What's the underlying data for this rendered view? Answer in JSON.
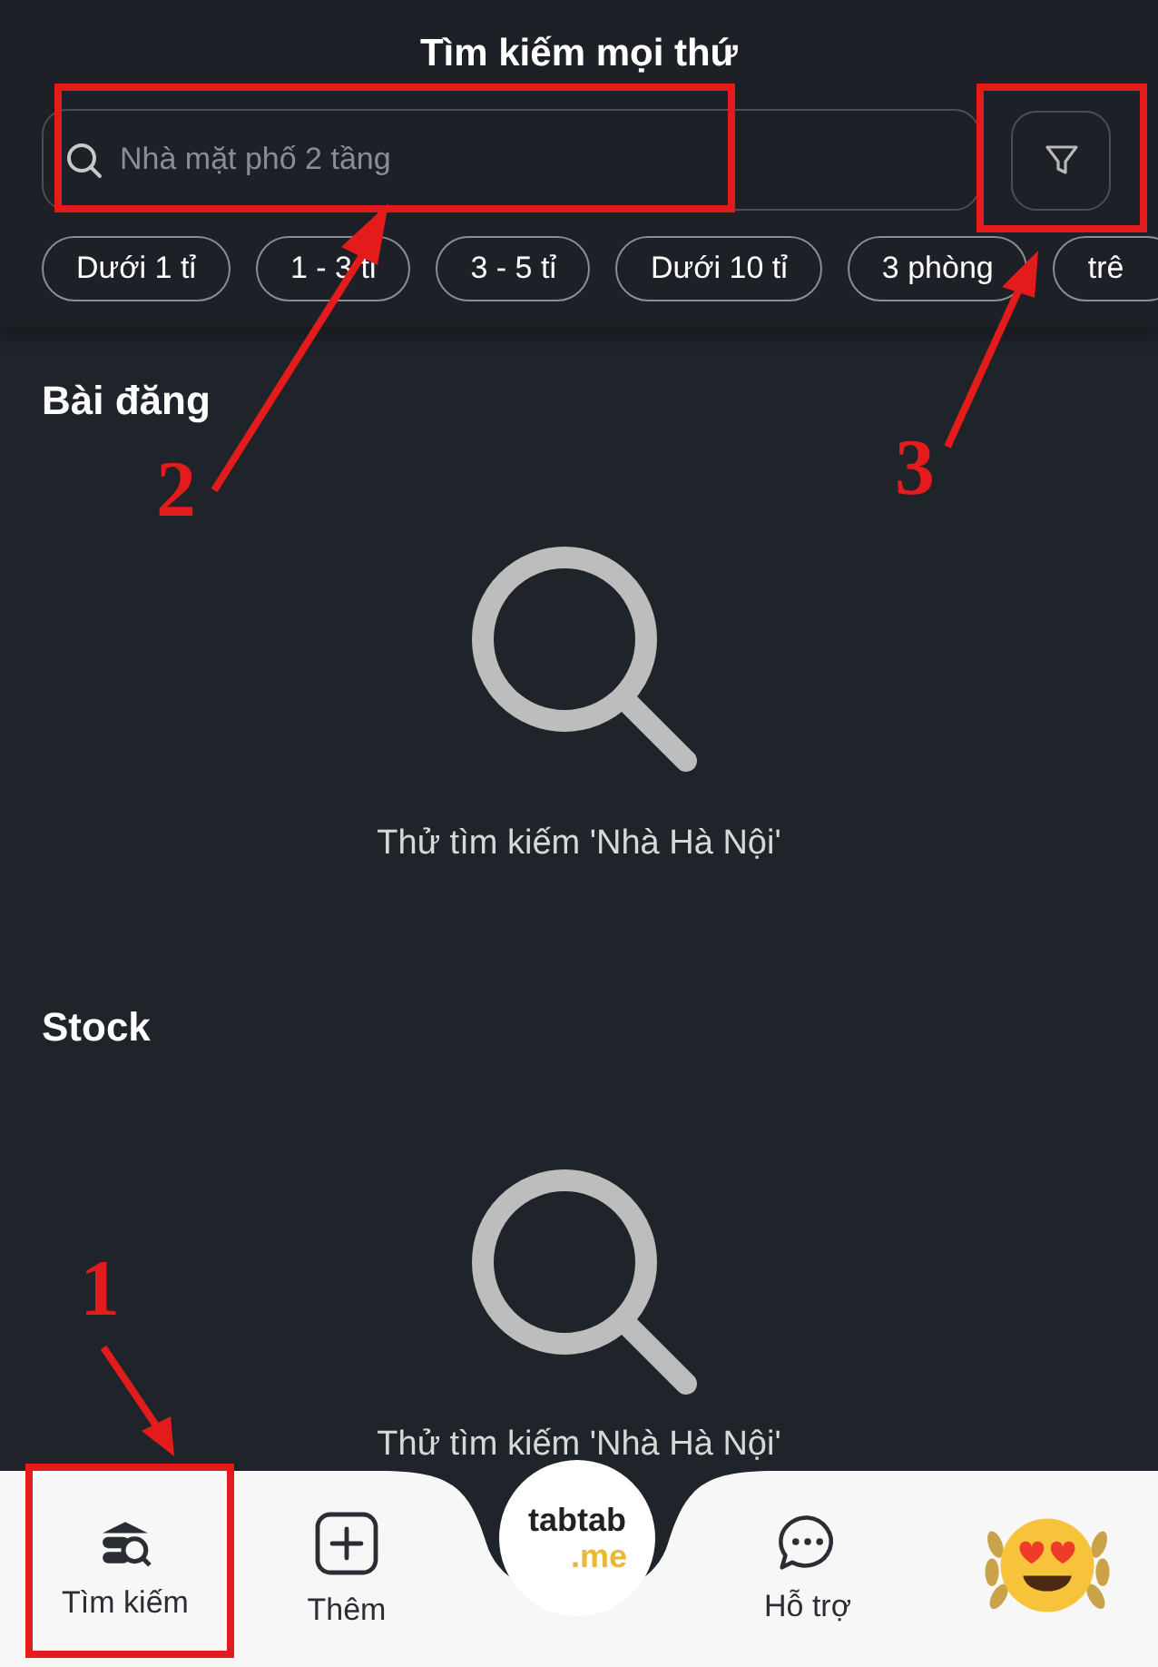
{
  "header": {
    "title": "Tìm kiếm mọi thứ",
    "search": {
      "placeholder": "Nhà mặt phố 2 tầng"
    }
  },
  "chips": [
    "Dưới 1 tỉ",
    "1 - 3 tỉ",
    "3 - 5 tỉ",
    "Dưới 10 tỉ",
    "3 phòng",
    "trê"
  ],
  "sections": [
    {
      "title": "Bài đăng",
      "empty_text": "Thử tìm kiếm 'Nhà Hà Nội'"
    },
    {
      "title": "Stock",
      "empty_text": "Thử tìm kiếm 'Nhà Hà Nội'"
    }
  ],
  "bottom_nav": {
    "items": [
      {
        "kind": "search",
        "label": "Tìm kiếm"
      },
      {
        "kind": "add",
        "label": "Thêm"
      },
      {
        "kind": "logo",
        "label": "tabtab",
        "suffix": ".me"
      },
      {
        "kind": "chat",
        "label": "Hỗ trợ"
      },
      {
        "kind": "avatar"
      }
    ]
  },
  "annotations": [
    {
      "number": "2"
    },
    {
      "number": "3"
    },
    {
      "number": "1"
    }
  ]
}
